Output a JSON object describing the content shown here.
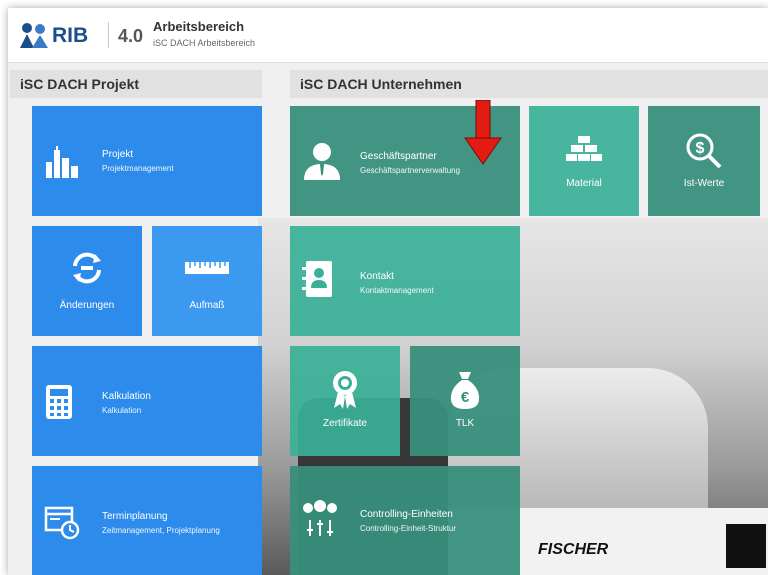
{
  "header": {
    "logo_text": "RIB",
    "version": "4.0",
    "title": "Arbeitsbereich",
    "subtitle": "iSC DACH Arbeitsbereich"
  },
  "sections": {
    "projekt": "iSC DACH Projekt",
    "unternehmen": "iSC DACH Unternehmen"
  },
  "tiles": {
    "projekt": {
      "title": "Projekt",
      "subtitle": "Projektmanagement"
    },
    "aenderungen": {
      "label": "Änderungen"
    },
    "aufmass": {
      "label": "Aufmaß"
    },
    "kalkulation": {
      "title": "Kalkulation",
      "subtitle": "Kalkulation"
    },
    "terminplanung": {
      "title": "Terminplanung",
      "subtitle": "Zeitmanagement, Projektplanung"
    },
    "geschaeftspartner": {
      "title": "Geschäftspartner",
      "subtitle": "Geschäftspartnerverwaltung"
    },
    "material": {
      "label": "Material"
    },
    "istwerte": {
      "label": "Ist-Werte"
    },
    "kontakt": {
      "title": "Kontakt",
      "subtitle": "Kontaktmanagement"
    },
    "zertifikate": {
      "label": "Zertifikate"
    },
    "tlk": {
      "label": "TLK"
    },
    "controlling": {
      "title": "Controlling-Einheiten",
      "subtitle": "Controlling-Einheit-Struktur"
    }
  },
  "background": {
    "truck_lettering_1": "FISCHER",
    "truck_lettering_2": "FISCHER"
  },
  "icons": {
    "projekt": "city-skyline-icon",
    "aenderungen": "sync-changes-icon",
    "aufmass": "ruler-icon",
    "kalkulation": "calculator-icon",
    "terminplanung": "calendar-clock-icon",
    "geschaeftspartner": "business-person-icon",
    "material": "bricks-icon",
    "istwerte": "money-search-icon",
    "kontakt": "address-book-icon",
    "zertifikate": "award-icon",
    "tlk": "euro-bag-icon",
    "controlling": "hierarchy-dots-icon",
    "annotation": "red-arrow-down-icon"
  },
  "colors": {
    "blue_tile": "#2d8ceb",
    "teal_tile": "#3ab098",
    "dark_teal_tile": "#398f7c",
    "annotation_arrow": "#e31b12",
    "brand": "#1b4f8a"
  }
}
